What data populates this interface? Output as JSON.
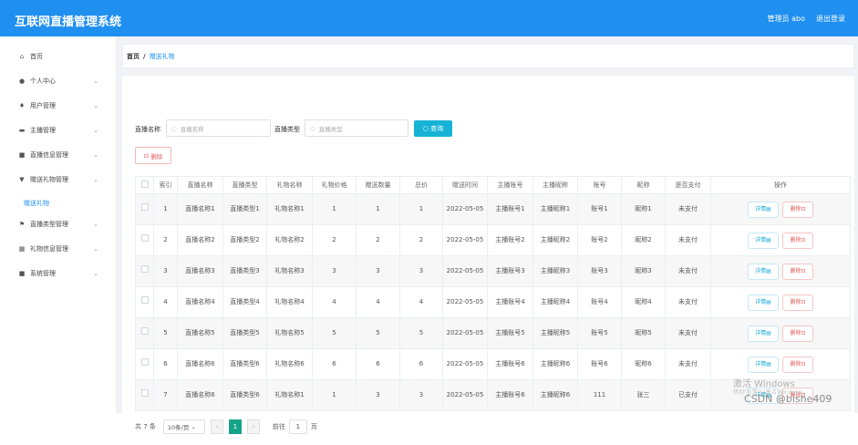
{
  "header": {
    "title": "互联网直播管理系统",
    "admin": "管理员 abo",
    "logout": "退出登录"
  },
  "sidebar": {
    "items": [
      {
        "icon": "home-icon",
        "glyph": "⌂",
        "label": "首页",
        "arrow": ""
      },
      {
        "icon": "user-icon",
        "glyph": "●",
        "label": "个人中心",
        "arrow": "⌄"
      },
      {
        "icon": "user-manage-icon",
        "glyph": "♦",
        "label": "用户管理",
        "arrow": "⌄"
      },
      {
        "icon": "anchor-icon",
        "glyph": "▬",
        "label": "主播管理",
        "arrow": "⌄"
      },
      {
        "icon": "live-info-icon",
        "glyph": "■",
        "label": "直播信息管理",
        "arrow": "⌄"
      },
      {
        "icon": "gift-icon",
        "glyph": "▼",
        "label": "赠送礼物管理",
        "arrow": "⌄"
      },
      {
        "icon": "flag-icon",
        "glyph": "⚑",
        "label": "直播类型管理",
        "arrow": "⌄"
      },
      {
        "icon": "grid-icon",
        "glyph": "▦",
        "label": "礼物信息管理",
        "arrow": "⌄"
      },
      {
        "icon": "system-icon",
        "glyph": "■",
        "label": "系统管理",
        "arrow": "⌄"
      }
    ],
    "sub_active": "赠送礼物"
  },
  "breadcrumb": {
    "home": "首页",
    "sep": "/",
    "current": "赠送礼物"
  },
  "filters": {
    "name_label": "直播名称",
    "name_placeholder": "直播名称",
    "type_label": "直播类型",
    "type_placeholder": "直播类型",
    "search_button": "查询"
  },
  "toolbar": {
    "delete_label": "删除"
  },
  "table": {
    "headers": [
      "",
      "索引",
      "直播名称",
      "直播类型",
      "礼物名称",
      "礼物价格",
      "赠送数量",
      "总价",
      "赠送时间",
      "主播账号",
      "主播昵称",
      "账号",
      "昵称",
      "是否支付",
      "操作"
    ],
    "rows": [
      [
        "1",
        "直播名称1",
        "直播类型1",
        "礼物名称1",
        "1",
        "1",
        "1",
        "2022-05-05",
        "主播账号1",
        "主播昵称1",
        "账号1",
        "昵称1",
        "未支付"
      ],
      [
        "2",
        "直播名称2",
        "直播类型2",
        "礼物名称2",
        "2",
        "2",
        "2",
        "2022-05-05",
        "主播账号2",
        "主播昵称2",
        "账号2",
        "昵称2",
        "未支付"
      ],
      [
        "3",
        "直播名称3",
        "直播类型3",
        "礼物名称3",
        "3",
        "3",
        "3",
        "2022-05-05",
        "主播账号3",
        "主播昵称3",
        "账号3",
        "昵称3",
        "未支付"
      ],
      [
        "4",
        "直播名称4",
        "直播类型4",
        "礼物名称4",
        "4",
        "4",
        "4",
        "2022-05-05",
        "主播账号4",
        "主播昵称4",
        "账号4",
        "昵称4",
        "未支付"
      ],
      [
        "5",
        "直播名称5",
        "直播类型5",
        "礼物名称5",
        "5",
        "5",
        "5",
        "2022-05-05",
        "主播账号5",
        "主播昵称5",
        "账号5",
        "昵称5",
        "未支付"
      ],
      [
        "6",
        "直播名称6",
        "直播类型6",
        "礼物名称6",
        "6",
        "6",
        "6",
        "2022-05-05",
        "主播账号6",
        "主播昵称6",
        "账号6",
        "昵称6",
        "未支付"
      ],
      [
        "7",
        "直播名称6",
        "直播类型6",
        "礼物名称1",
        "1",
        "3",
        "3",
        "2022-05-05",
        "主播账号6",
        "主播昵称6",
        "111",
        "张三",
        "已支付"
      ]
    ],
    "detail_label": "详情",
    "row_delete_label": "删除"
  },
  "pager": {
    "total": "共 7 条",
    "page_size": "10条/页",
    "current": "1",
    "goto_label": "前往",
    "goto_value": "1",
    "page_suffix": "页"
  },
  "overlay": {
    "activate": "激活 Windows",
    "activate_hint": "转到\"设置\"以激活 Windows。",
    "csdn": "CSDN @bishe409"
  },
  "colors": {
    "header": "#1f8ff0",
    "search": "#17b3d6",
    "active_page": "#17a38a",
    "danger": "#e05a5a"
  }
}
